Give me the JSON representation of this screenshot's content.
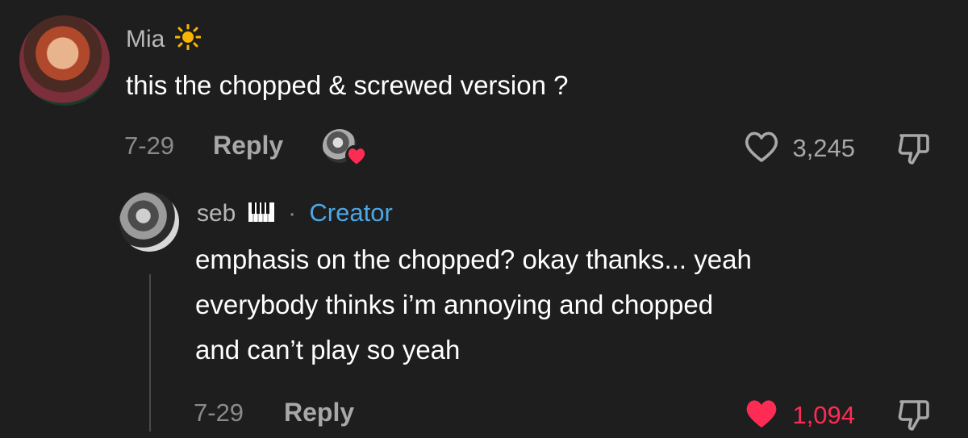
{
  "comment": {
    "username": "Mia",
    "username_emoji": "☀️",
    "text": "this the chopped & screwed version ?",
    "date": "7-29",
    "reply_label": "Reply",
    "like_count": "3,245",
    "liked": false
  },
  "reply": {
    "username": "seb",
    "username_emoji": "🎹",
    "separator": "·",
    "creator_label": "Creator",
    "text_line1": "emphasis on the chopped? okay thanks... yeah",
    "text_line2": "everybody thinks i’m annoying and chopped",
    "text_line3": "and can’t play so yeah",
    "date": "7-29",
    "reply_label": "Reply",
    "like_count": "1,094",
    "liked": true
  },
  "colors": {
    "background": "#1e1e1e",
    "accent_blue": "#4aa8e6",
    "like_red": "#fe2c55"
  }
}
